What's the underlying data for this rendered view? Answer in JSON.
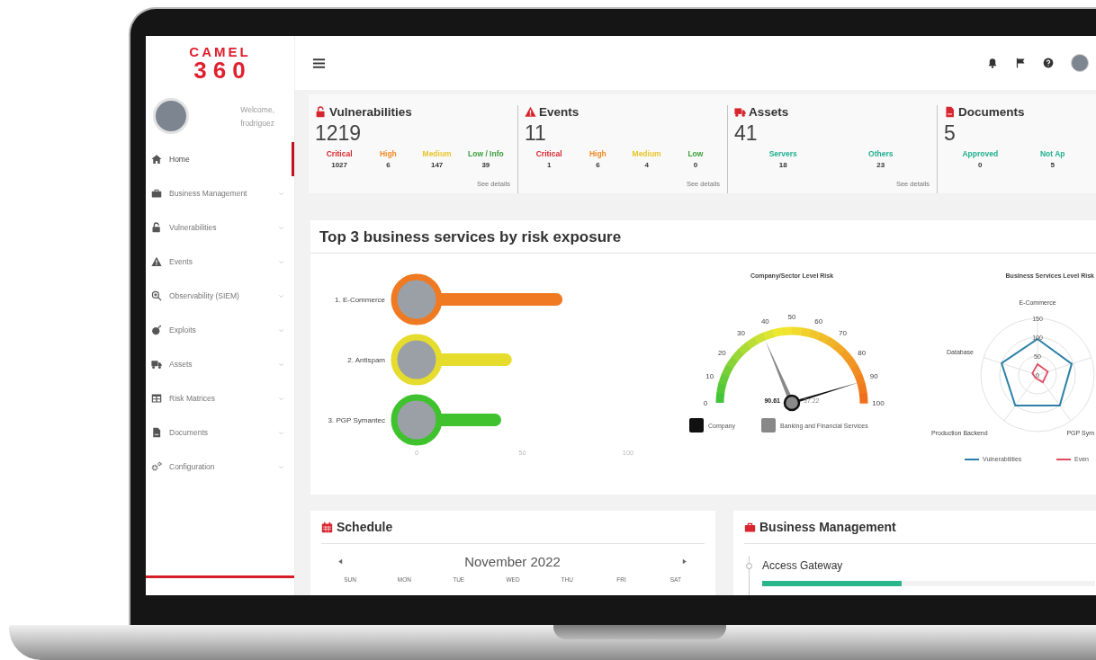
{
  "logo": {
    "name": "CAMEL",
    "number": "360"
  },
  "sidebar": {
    "welcome": "Welcome,",
    "username": "frodriguez",
    "items": [
      {
        "label": "Home",
        "selected": true,
        "expandable": false
      },
      {
        "label": "Business Management",
        "selected": false,
        "expandable": true
      },
      {
        "label": "Vulnerabilities",
        "selected": false,
        "expandable": true
      },
      {
        "label": "Events",
        "selected": false,
        "expandable": true
      },
      {
        "label": "Observability (SIEM)",
        "selected": false,
        "expandable": true
      },
      {
        "label": "Exploits",
        "selected": false,
        "expandable": true
      },
      {
        "label": "Assets",
        "selected": false,
        "expandable": true
      },
      {
        "label": "Risk Matrices",
        "selected": false,
        "expandable": true
      },
      {
        "label": "Documents",
        "selected": false,
        "expandable": true
      },
      {
        "label": "Configuration",
        "selected": false,
        "expandable": true
      }
    ]
  },
  "stats": [
    {
      "title": "Vulnerabilities",
      "total": "1219",
      "link": "See details",
      "breakdown": [
        {
          "label": "Critical",
          "value": "1027",
          "color": "#d9262e"
        },
        {
          "label": "High",
          "value": "6",
          "color": "#f08a24"
        },
        {
          "label": "Medium",
          "value": "147",
          "color": "#e8c52c"
        },
        {
          "label": "Low / Info",
          "value": "39",
          "color": "#3a9e3a"
        }
      ]
    },
    {
      "title": "Events",
      "total": "11",
      "link": "See details",
      "breakdown": [
        {
          "label": "Critical",
          "value": "1",
          "color": "#d9262e"
        },
        {
          "label": "High",
          "value": "6",
          "color": "#f08a24"
        },
        {
          "label": "Medium",
          "value": "4",
          "color": "#e8c52c"
        },
        {
          "label": "Low",
          "value": "0",
          "color": "#3a9e3a"
        }
      ]
    },
    {
      "title": "Assets",
      "total": "41",
      "link": "See details",
      "breakdown": [
        {
          "label": "Servers",
          "value": "18",
          "color": "#20b08f"
        },
        {
          "label": "Others",
          "value": "23",
          "color": "#20b08f"
        }
      ]
    },
    {
      "title": "Documents",
      "total": "5",
      "breakdown": [
        {
          "label": "Approved",
          "value": "0",
          "color": "#20b08f"
        },
        {
          "label": "Not Ap",
          "value": "5",
          "color": "#20b08f"
        }
      ]
    }
  ],
  "risk": {
    "title": "Top 3 business services by risk exposure",
    "bar_chart": {
      "chart_data": {
        "type": "bar",
        "orientation": "horizontal",
        "categories": [
          "1. E-Commerce",
          "2. Antispam",
          "3. PGP Symantec"
        ],
        "values": [
          69,
          45,
          40
        ],
        "xlim": [
          0,
          100
        ],
        "xticks": [
          {
            "value": 0,
            "label": "0"
          },
          {
            "value": 50,
            "label": "50"
          },
          {
            "value": 100,
            "label": "100"
          }
        ]
      },
      "rings": [
        {
          "color": "#f07a22"
        },
        {
          "color": "#e6dc2e"
        },
        {
          "color": "#3fc22e"
        }
      ]
    },
    "gauge": {
      "title": "Company/Sector Level Risk",
      "tick_labels": [
        "0",
        "10",
        "20",
        "30",
        "40",
        "50",
        "60",
        "70",
        "80",
        "90",
        "100"
      ],
      "needles": [
        {
          "level": 0.9061,
          "color": "#111111"
        },
        {
          "level": 0.3722,
          "color": "#888888"
        }
      ],
      "readings": [
        "90.61",
        "37.22"
      ],
      "legend": [
        {
          "label": "Company",
          "color": "#111111"
        },
        {
          "label": "Banking and Financial Services",
          "color": "#888888"
        }
      ]
    },
    "radar": {
      "title": "Business Services Level Risk",
      "axis_labels": [
        "E-Commerce",
        "Database",
        "Production Backend",
        "PGP Sym"
      ],
      "ring_labels": [
        "150",
        "100",
        "50",
        "0"
      ],
      "legend": [
        {
          "label": "Vulnerabilities",
          "color": "#2b7fa6"
        },
        {
          "label": "Even",
          "color": "#e04a5f"
        }
      ]
    }
  },
  "schedule": {
    "title": "Schedule",
    "month": "November 2022",
    "weekdays": [
      "SUN",
      "MON",
      "TUE",
      "WED",
      "THU",
      "FRI",
      "SAT"
    ]
  },
  "business_management": {
    "title": "Business Management",
    "items": [
      {
        "name": "Access Gateway",
        "level": 0.42
      }
    ]
  }
}
